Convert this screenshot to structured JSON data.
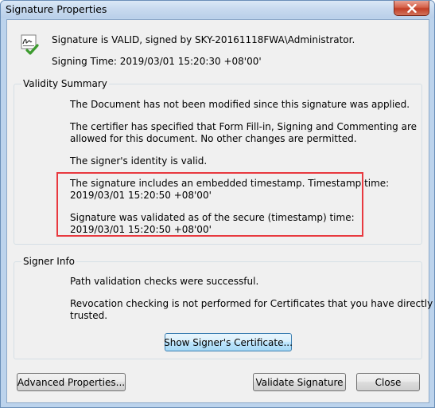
{
  "window": {
    "title": "Signature Properties",
    "close_icon": "close-x-icon"
  },
  "header": {
    "icon": "signature-valid-icon",
    "status_line": "Signature is VALID, signed by SKY-20161118FWA\\Administrator.",
    "signing_time": "Signing Time:  2019/03/01 15:20:30 +08'00'"
  },
  "validity_summary": {
    "title": "Validity Summary",
    "lines": [
      "The Document has not been modified since this signature was applied.",
      "The certifier has specified that Form Fill-in, Signing and Commenting are",
      "allowed for this document. No other changes are permitted.",
      "The signer's identity is valid.",
      "The signature includes an embedded timestamp. Timestamp time:",
      "2019/03/01 15:20:50 +08'00'",
      "Signature was validated as of the secure (timestamp) time:",
      "2019/03/01 15:20:50 +08'00'"
    ]
  },
  "signer_info": {
    "title": "Signer Info",
    "lines": [
      "Path validation checks were successful.",
      "Revocation checking is not performed for Certificates that you have directly",
      "trusted."
    ],
    "show_certificate_label": "Show Signer's Certificate..."
  },
  "footer": {
    "advanced_label": "Advanced Properties...",
    "validate_label": "Validate Signature",
    "close_label": "Close"
  },
  "colors": {
    "highlight_border": "#e8393f",
    "titlebar": "#c8daef",
    "close_button": "#c94a33",
    "dialog_background": "#f0f0f0"
  }
}
